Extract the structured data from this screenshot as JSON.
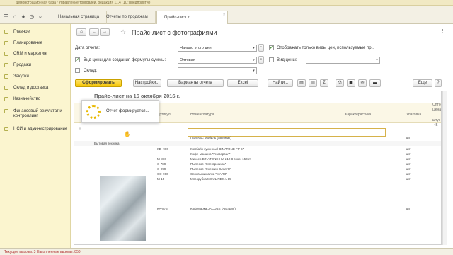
{
  "window": {
    "title": "Демонстрационная база / Управление торговлей, редакция 11.4 (1С:Предприятие)"
  },
  "tabs": [
    {
      "label": "Начальная страница"
    },
    {
      "label": "Отчеты по продажам"
    },
    {
      "label": "Прайс-лист с фотографиями"
    }
  ],
  "sidebar": {
    "items": [
      {
        "label": "Главное"
      },
      {
        "label": "Планирование"
      },
      {
        "label": "CRM и маркетинг"
      },
      {
        "label": "Продажи"
      },
      {
        "label": "Закупки"
      },
      {
        "label": "Склад и доставка"
      },
      {
        "label": "Казначейство"
      },
      {
        "label": "Финансовый результат и контроллинг"
      },
      {
        "label": "НСИ и администрирование"
      }
    ]
  },
  "form": {
    "title": "Прайс-лист с фотографиями",
    "report_date_label": "Дата отчета:",
    "report_date_value": "Начало этого дня",
    "price_type_label": "Вид цены для создания формулы суммы:",
    "price_type_value": "Оптовая",
    "warehouse_label": "Склад:",
    "show_only_label": "Отображать только виды цен, используемые пр...",
    "price_kinds_label": "Вид цены:"
  },
  "toolbar": {
    "generate": "Сформировать",
    "settings": "Настройки...",
    "variants": "Варианты отчета",
    "excel": "Excel",
    "find": "Найти...",
    "more": "Еще",
    "help": "?"
  },
  "report": {
    "title": "Прайс-лист на 16 октября 2016 г.",
    "columns": {
      "article": "Артикул",
      "nomenclature": "Номенклатура",
      "characteristic": "Характеристика",
      "package": "Упаковка",
      "opt": "Опто",
      "price": "Цена",
      "qty": "штук",
      "val": "45"
    },
    "group": "Бытовая техника",
    "rows": [
      {
        "article": "",
        "name": "Пылесос Мобиль (Автомат)",
        "unit": "шт"
      },
      {
        "article": "КВ- 900",
        "name": "Комбайн кухонный BINATONE FP 67",
        "unit": "шт"
      },
      {
        "article": "",
        "name": "Кофе-машина \"Универсал\"",
        "unit": "шт"
      },
      {
        "article": "М-876",
        "name": "Миксер BINATONE HM 212 8 скор. 150вт",
        "unit": "шт"
      },
      {
        "article": "Э-789",
        "name": "Пылесос \"Электросила\"",
        "unit": "шт"
      },
      {
        "article": "Э-999",
        "name": "Пылесос \"Энергия-SANYO\"",
        "unit": "шт"
      },
      {
        "article": "СО-900",
        "name": "Соковыжималка \"МАПО\"",
        "unit": "шт"
      },
      {
        "article": "М-15",
        "name": "Мясорубка MOULINEX A 15",
        "unit": "шт"
      },
      {
        "article": "КА-876",
        "name": "Кофеварка JACOBS (Австрия)",
        "unit": "шт"
      }
    ],
    "loading": "Отчет формируется..."
  },
  "status": {
    "text": "Текущие вызовы: 3   Накопленные вызовы: 850"
  },
  "colors": {
    "accent": "#f5c400",
    "sidebar": "#fbf5cf"
  }
}
